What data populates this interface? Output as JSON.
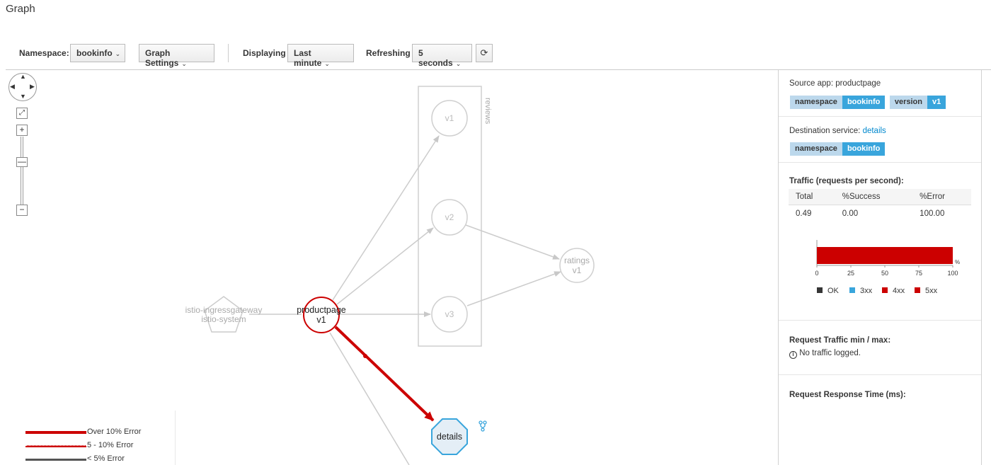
{
  "page": {
    "title": "Graph"
  },
  "toolbar": {
    "namespace_label": "Namespace:",
    "namespace_value": "bookinfo",
    "graph_settings": "Graph Settings",
    "displaying_label": "Displaying",
    "displaying_value": "Last minute",
    "refreshing_label": "Refreshing",
    "refreshing_value": "5 seconds",
    "refresh_icon": "refresh-icon"
  },
  "graph": {
    "nodes": {
      "gateway_line1": "istio-ingressgateway",
      "gateway_line2": "istio-system",
      "productpage_line1": "productpage",
      "productpage_line2": "v1",
      "reviews_group": "reviews",
      "reviews_v1": "v1",
      "reviews_v2": "v2",
      "reviews_v3": "v3",
      "ratings_line1": "ratings",
      "ratings_line2": "v1",
      "details": "details"
    },
    "colors": {
      "error": "#cc0000",
      "faded": "#cccccc",
      "service": "#39a5dc",
      "service_fill": "#e4eef6"
    }
  },
  "legend": {
    "items": [
      {
        "label": "Over 10% Error",
        "color": "#cc0000"
      },
      {
        "label": "5 - 10% Error",
        "color": "#cc0000"
      },
      {
        "label": "< 5% Error",
        "color": "#555555"
      }
    ]
  },
  "sidepanel": {
    "source_label": "Source app: productpage",
    "source_tags": [
      {
        "key": "namespace",
        "value": "bookinfo"
      },
      {
        "key": "version",
        "value": "v1"
      }
    ],
    "destination_label": "Destination service:",
    "destination_link": "details",
    "destination_tags": [
      {
        "key": "namespace",
        "value": "bookinfo"
      }
    ],
    "traffic_title": "Traffic (requests per second):",
    "traffic_headers": [
      "Total",
      "%Success",
      "%Error"
    ],
    "traffic_values": [
      "0.49",
      "0.00",
      "100.00"
    ],
    "request_traffic_title": "Request Traffic min / max:",
    "no_traffic": "No traffic logged.",
    "response_time_title": "Request Response Time (ms):"
  },
  "chart_data": {
    "type": "bar",
    "orientation": "horizontal",
    "categories": [
      ""
    ],
    "series": [
      {
        "name": "OK",
        "values": [
          0
        ],
        "color": "#363636"
      },
      {
        "name": "3xx",
        "values": [
          0
        ],
        "color": "#39a5dc"
      },
      {
        "name": "4xx",
        "values": [
          0
        ],
        "color": "#cc0000"
      },
      {
        "name": "5xx",
        "values": [
          100
        ],
        "color": "#cc0000"
      }
    ],
    "xlim": [
      0,
      100
    ],
    "xticks": [
      "0",
      "25",
      "50",
      "75",
      "100"
    ],
    "unit": "%",
    "legend_position": "bottom"
  }
}
